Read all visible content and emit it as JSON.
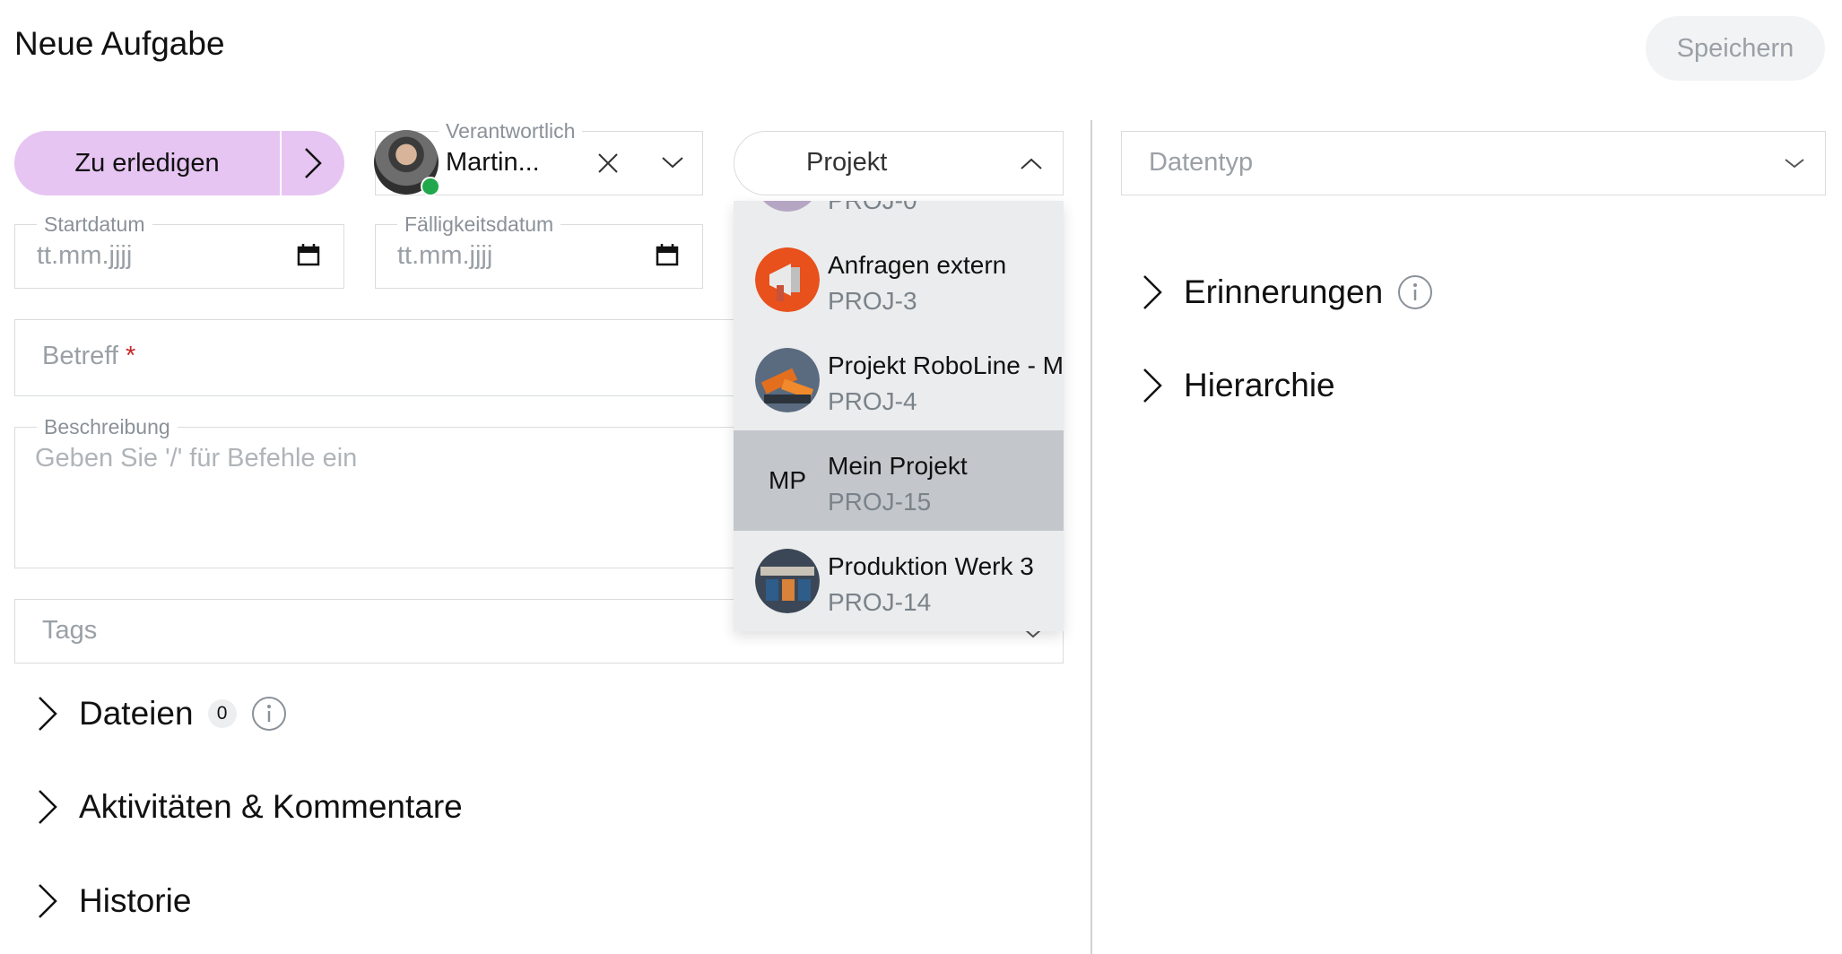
{
  "header": {
    "title": "Neue Aufgabe",
    "save_label": "Speichern"
  },
  "status": {
    "label": "Zu erledigen"
  },
  "assignee": {
    "legend": "Verantwortlich",
    "value": "Martin..."
  },
  "project": {
    "label": "Projekt"
  },
  "datatype": {
    "placeholder": "Datentyp"
  },
  "dates": {
    "start_legend": "Startdatum",
    "start_placeholder": "tt.mm.jjjj",
    "due_legend": "Fälligkeitsdatum",
    "due_placeholder": "tt.mm.jjjj"
  },
  "subject": {
    "placeholder": "Betreff",
    "required_mark": "*"
  },
  "description": {
    "legend": "Beschreibung",
    "placeholder": "Geben Sie '/' für Befehle ein"
  },
  "tags": {
    "placeholder": "Tags"
  },
  "project_dropdown": {
    "partial_key": "PROJ-0",
    "items": [
      {
        "name": "Anfragen extern",
        "key": "PROJ-3",
        "avatar": "megaphone-image"
      },
      {
        "name": "Projekt RoboLine - M",
        "key": "PROJ-4",
        "avatar": "robot-arm-image"
      },
      {
        "name": "Mein Projekt",
        "key": "PROJ-15",
        "initials": "MP",
        "selected": true
      },
      {
        "name": "Produktion Werk 3",
        "key": "PROJ-14",
        "avatar": "factory-image"
      }
    ]
  },
  "sections_left": {
    "files": {
      "label": "Dateien",
      "count": "0"
    },
    "activities": {
      "label": "Aktivitäten & Kommentare"
    },
    "history": {
      "label": "Historie"
    }
  },
  "sections_right": {
    "reminders": {
      "label": "Erinnerungen"
    },
    "hierarchy": {
      "label": "Hierarchie"
    }
  },
  "colors": {
    "status_bg": "#e6c5f2",
    "selected_item_bg": "#c3c7cc",
    "dropdown_bg": "#ebeced",
    "online": "#22a84c",
    "required": "#c62828"
  }
}
